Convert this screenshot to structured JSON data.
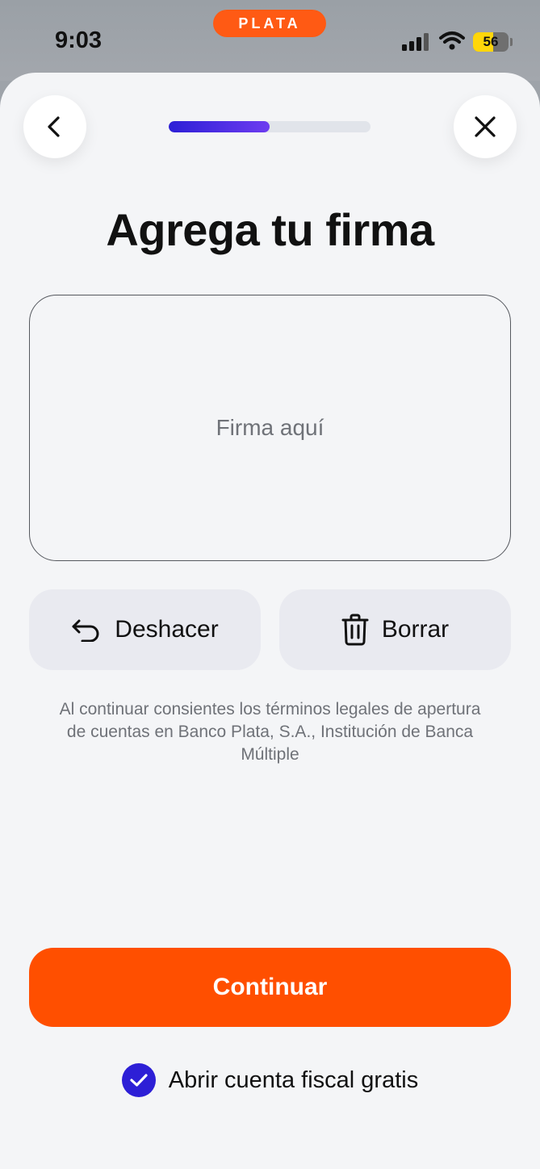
{
  "status_bar": {
    "time": "9:03",
    "brand": "PLATA",
    "battery_level": "56",
    "battery_fraction": 0.56
  },
  "header": {
    "back_icon": "chevron-left-icon",
    "close_icon": "close-icon",
    "progress_fraction": 0.5
  },
  "page": {
    "title": "Agrega tu firma",
    "signature_placeholder": "Firma aquí",
    "undo_label": "Deshacer",
    "clear_label": "Borrar",
    "legal_text": "Al continuar consientes los términos legales de apertura de cuentas en Banco Plata, S.A., Institución de Banca Múltiple",
    "continue_label": "Continuar",
    "fiscal_label": "Abrir cuenta fiscal gratis",
    "fiscal_checked": true
  },
  "colors": {
    "accent": "#FF4F00",
    "brand_orange": "#FF5A14",
    "progress": "#2D1FD6",
    "checkbox": "#2D1FD6"
  }
}
